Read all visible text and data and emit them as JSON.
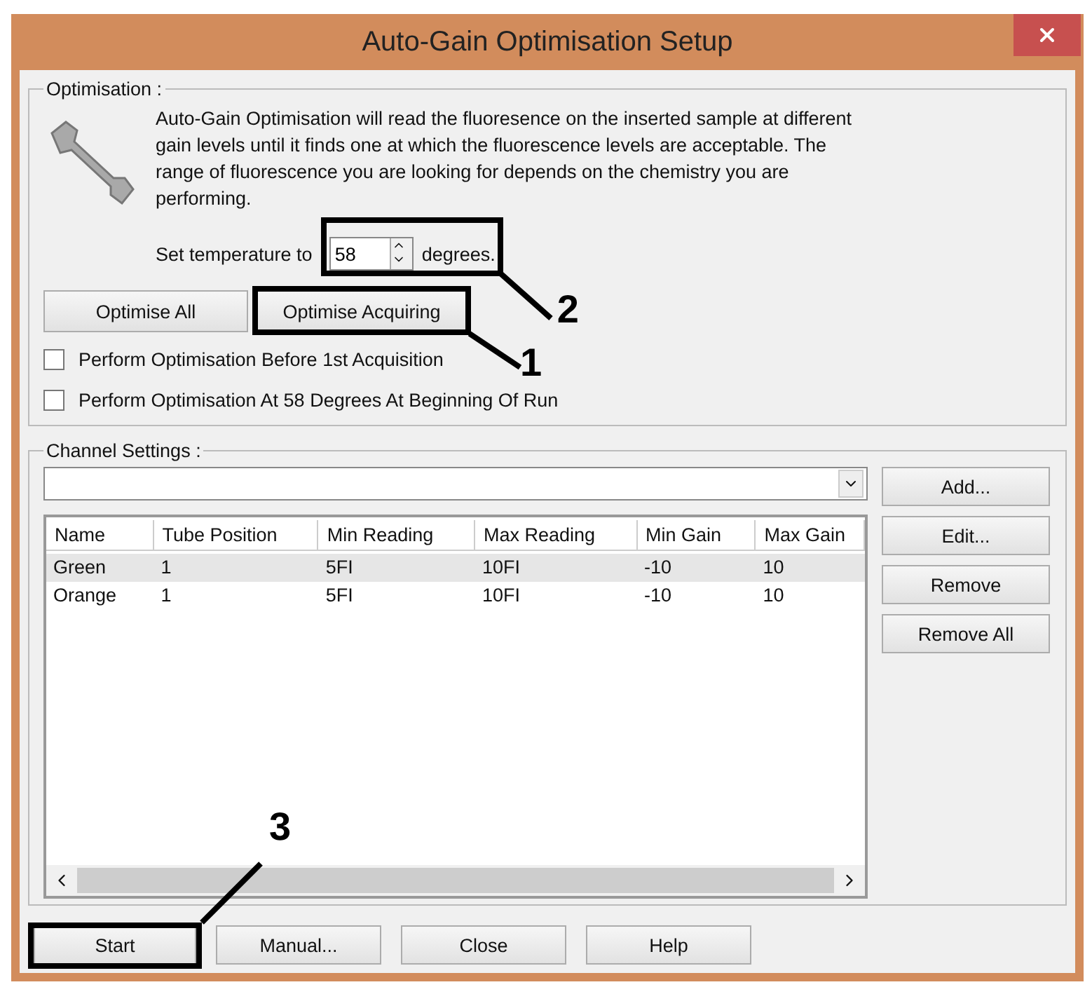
{
  "window": {
    "title": "Auto-Gain Optimisation Setup"
  },
  "optimisation": {
    "legend": "Optimisation :",
    "description": "Auto-Gain Optimisation will read the fluoresence on the inserted sample at different gain levels until it finds one at which the fluorescence levels are acceptable. The range of fluorescence you are looking for depends on the chemistry you are performing.",
    "temperature_label": "Set temperature to",
    "temperature_value": "58",
    "temperature_unit": "degrees.",
    "buttons": [
      "Optimise All",
      "Optimise Acquiring"
    ],
    "options": [
      {
        "label": "Perform Optimisation Before 1st Acquisition",
        "checked": false
      },
      {
        "label": "Perform Optimisation At 58 Degrees At Beginning Of Run",
        "checked": false
      }
    ]
  },
  "channel_settings": {
    "legend": "Channel Settings :",
    "columns": [
      "Name",
      "Tube Position",
      "Min Reading",
      "Max Reading",
      "Min Gain",
      "Max Gain"
    ],
    "rows": [
      {
        "cells": [
          "Green",
          "1",
          "5FI",
          "10FI",
          "-10",
          "10"
        ],
        "selected": true
      },
      {
        "cells": [
          "Orange",
          "1",
          "5FI",
          "10FI",
          "-10",
          "10"
        ],
        "selected": false
      }
    ],
    "side_buttons": [
      "Add...",
      "Edit...",
      "Remove",
      "Remove All"
    ]
  },
  "footer_buttons": [
    "Start",
    "Manual...",
    "Close",
    "Help"
  ],
  "annotations": [
    {
      "number": "2"
    },
    {
      "number": "1"
    },
    {
      "number": "3"
    }
  ]
}
